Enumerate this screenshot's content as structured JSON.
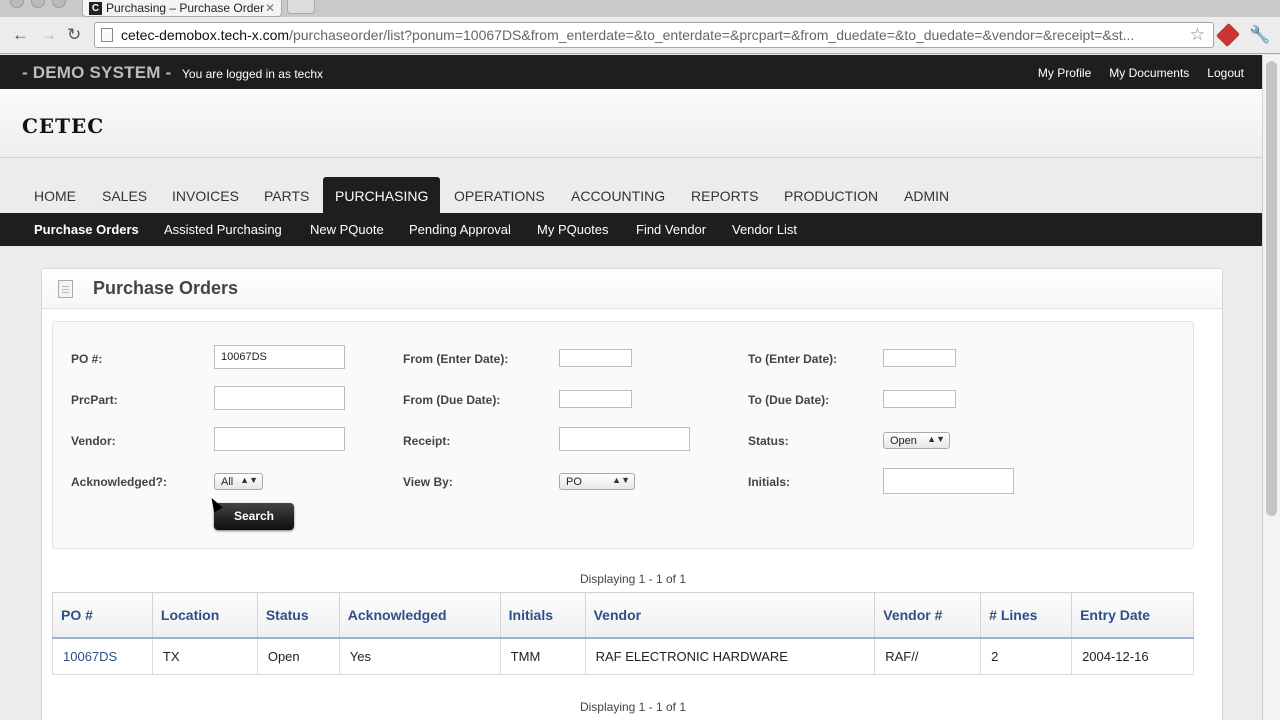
{
  "browser": {
    "tab_title": "Purchasing – Purchase Order",
    "favicon_letter": "C",
    "url_host": "cetec-demobox.tech-x.com",
    "url_rest": "/purchaseorder/list?ponum=10067DS&from_enterdate=&to_enterdate=&prcpart=&from_duedate=&to_duedate=&vendor=&receipt=&st..."
  },
  "topbar": {
    "system_label": "- DEMO SYSTEM -",
    "logged_in": "You are logged in as techx",
    "links": [
      "My Profile",
      "My Documents",
      "Logout"
    ]
  },
  "logo": "CETEC",
  "main_nav": [
    "HOME",
    "SALES",
    "INVOICES",
    "PARTS",
    "PURCHASING",
    "OPERATIONS",
    "ACCOUNTING",
    "REPORTS",
    "PRODUCTION",
    "ADMIN"
  ],
  "main_nav_active": "PURCHASING",
  "sub_nav": [
    "Purchase Orders",
    "Assisted Purchasing",
    "New PQuote",
    "Pending Approval",
    "My PQuotes",
    "Find Vendor",
    "Vendor List"
  ],
  "sub_nav_active": "Purchase Orders",
  "panel": {
    "title": "Purchase Orders"
  },
  "filters": {
    "po_label": "PO #:",
    "po_value": "10067DS",
    "prcpart_label": "PrcPart:",
    "prcpart_value": "",
    "vendor_label": "Vendor:",
    "vendor_value": "",
    "ack_label": "Acknowledged?:",
    "ack_value": "All",
    "from_enter_label": "From (Enter Date):",
    "from_enter_value": "",
    "from_due_label": "From (Due Date):",
    "from_due_value": "",
    "receipt_label": "Receipt:",
    "receipt_value": "",
    "viewby_label": "View By:",
    "viewby_value": "PO",
    "to_enter_label": "To (Enter Date):",
    "to_enter_value": "",
    "to_due_label": "To (Due Date):",
    "to_due_value": "",
    "status_label": "Status:",
    "status_value": "Open",
    "initials_label": "Initials:",
    "initials_value": "",
    "search_label": "Search"
  },
  "results": {
    "displaying": "Displaying 1 - 1 of 1",
    "columns": [
      "PO #",
      "Location",
      "Status",
      "Acknowledged",
      "Initials",
      "Vendor",
      "Vendor #",
      "# Lines",
      "Entry Date"
    ],
    "rows": [
      [
        "10067DS",
        "TX",
        "Open",
        "Yes",
        "TMM",
        "RAF ELECTRONIC HARDWARE",
        "RAF//",
        "2",
        "2004-12-16"
      ]
    ]
  }
}
